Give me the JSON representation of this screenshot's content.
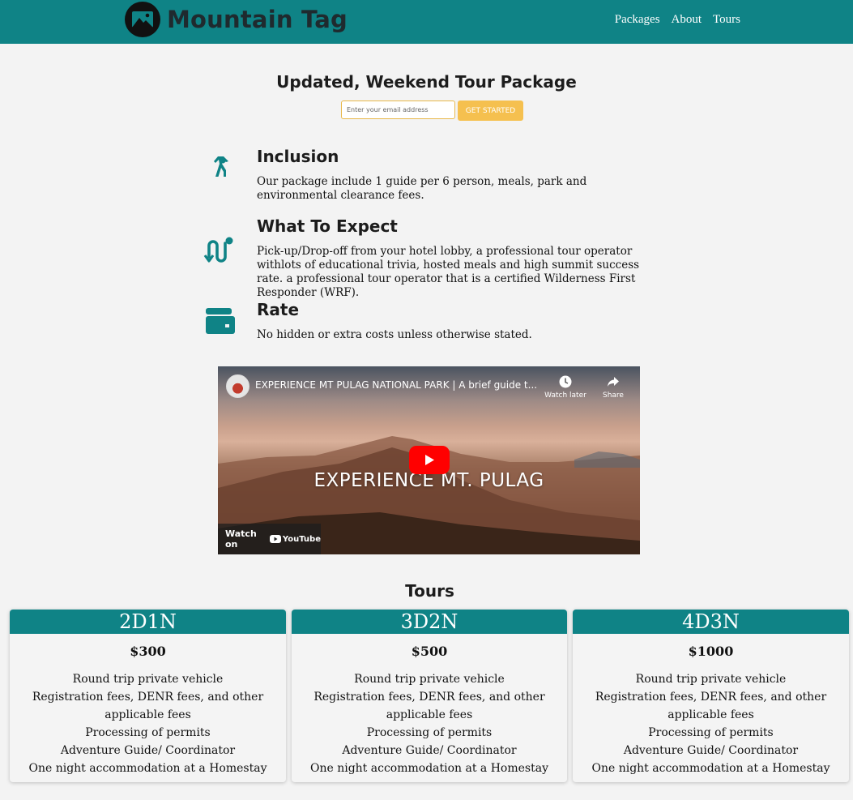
{
  "header": {
    "brand": "Mountain Tag",
    "nav": [
      "Packages",
      "About",
      "Tours"
    ]
  },
  "hero": {
    "title": "Updated, Weekend Tour Package",
    "email_placeholder": "Enter your email address",
    "cta_label": "GET STARTED"
  },
  "features": [
    {
      "icon": "walking-person-icon",
      "title": "Inclusion",
      "text": "Our package include 1 guide per 6 person, meals, park and environmental clearance fees."
    },
    {
      "icon": "route-icon",
      "title": "What To Expect",
      "text": "Pick-up/Drop-off from your hotel lobby, a professional tour operator withlots of educational trivia, hosted meals and high summit success rate. a professional tour operator that is a certified Wilderness First Responder (WRF)."
    },
    {
      "icon": "wallet-icon",
      "title": "Rate",
      "text": "No hidden or extra costs unless otherwise stated."
    }
  ],
  "video": {
    "title": "EXPERIENCE MT PULAG NATIONAL PARK | A brief guide t...",
    "overlay_text": "EXPERIENCE MT. PULAG",
    "watch_later": "Watch later",
    "share": "Share",
    "watch_on": "Watch on",
    "youtube": "YouTube"
  },
  "tours": {
    "title": "Tours",
    "cards": [
      {
        "name": "2D1N",
        "price": "$300",
        "items": [
          "Round trip private vehicle",
          "Registration fees, DENR fees, and other applicable fees",
          "Processing of permits",
          "Adventure Guide/ Coordinator",
          "One night accommodation at a Homestay"
        ]
      },
      {
        "name": "3D2N",
        "price": "$500",
        "items": [
          "Round trip private vehicle",
          "Registration fees, DENR fees, and other applicable fees",
          "Processing of permits",
          "Adventure Guide/ Coordinator",
          "One night accommodation at a Homestay"
        ]
      },
      {
        "name": "4D3N",
        "price": "$1000",
        "items": [
          "Round trip private vehicle",
          "Registration fees, DENR fees, and other applicable fees",
          "Processing of permits",
          "Adventure Guide/ Coordinator",
          "One night accommodation at a Homestay"
        ]
      }
    ]
  },
  "colors": {
    "primary": "#0f8386",
    "accent": "#f5c04f",
    "youtube_red": "#ff0000"
  }
}
